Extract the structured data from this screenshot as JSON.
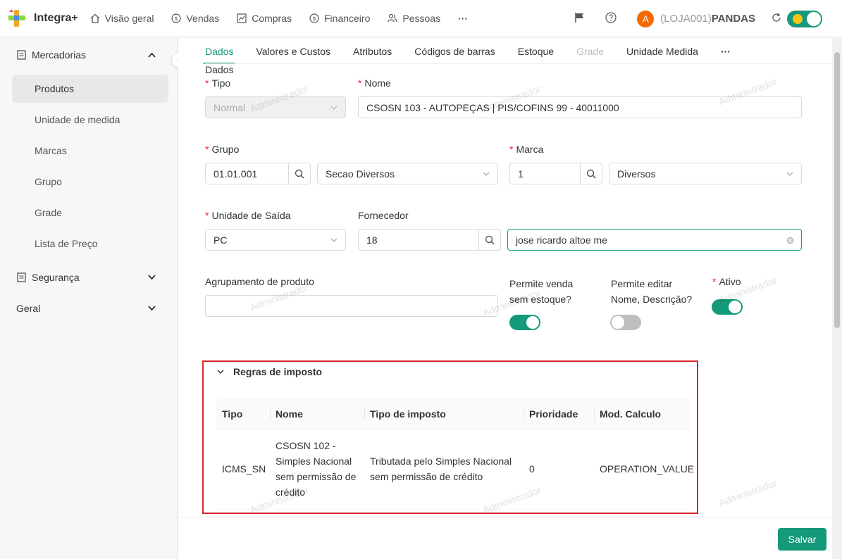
{
  "app": {
    "title": "Integra+"
  },
  "nav": {
    "items": [
      {
        "label": "Visão geral",
        "icon": "home-icon"
      },
      {
        "label": "Vendas",
        "icon": "dollar-icon"
      },
      {
        "label": "Compras",
        "icon": "chart-icon"
      },
      {
        "label": "Financeiro",
        "icon": "dollar-icon"
      },
      {
        "label": "Pessoas",
        "icon": "users-icon"
      }
    ],
    "more": "···"
  },
  "user": {
    "avatar_letter": "A",
    "store_code": "(LOJA001)",
    "store_name": "PANDAS"
  },
  "sidebar": {
    "groups": [
      {
        "label": "Mercadorias",
        "icon": "box-icon",
        "expanded": true
      },
      {
        "label": "Segurança",
        "icon": "lock-icon",
        "expanded": false
      },
      {
        "label": "Geral",
        "expanded": false
      }
    ],
    "items": [
      "Produtos",
      "Unidade de medida",
      "Marcas",
      "Grupo",
      "Grade",
      "Lista de Preço"
    ],
    "active_item": "Produtos"
  },
  "tabs": [
    "Dados",
    "Valores e Custos",
    "Atributos",
    "Códigos de barras",
    "Estoque",
    "Grade",
    "Unidade Medida",
    "···"
  ],
  "section_title": "Dados",
  "form": {
    "tipo": {
      "label": "Tipo",
      "value": "Normal"
    },
    "nome": {
      "label": "Nome",
      "value": "CSOSN 103 - AUTOPEÇAS | PIS/COFINS 99 - 40011000"
    },
    "grupo": {
      "label": "Grupo",
      "code": "01.01.001",
      "value": "Secao Diversos"
    },
    "marca": {
      "label": "Marca",
      "code": "1",
      "value": "Diversos"
    },
    "unidade_saida": {
      "label": "Unidade de Saída",
      "value": "PC"
    },
    "fornecedor": {
      "label": "Fornecedor",
      "code": "18",
      "value": "jose ricardo altoe me"
    },
    "agrupamento": {
      "label": "Agrupamento de produto",
      "value": ""
    },
    "permite_venda": {
      "label_line1": "Permite venda",
      "label_line2": "sem estoque?",
      "on": true
    },
    "permite_editar": {
      "label_line1": "Permite editar",
      "label_line2": "Nome, Descrição?",
      "on": false
    },
    "ativo": {
      "label": "Ativo",
      "on": true
    }
  },
  "tax_rules": {
    "title": "Regras de imposto",
    "columns": [
      "Tipo",
      "Nome",
      "Tipo de imposto",
      "Prioridade",
      "Mod. Calculo"
    ],
    "row": {
      "tipo": "ICMS_SN",
      "nome_lines": [
        "CSOSN 102 -",
        "Simples Nacional",
        "sem permissão de",
        "crédito"
      ],
      "tipo_imposto_lines": [
        "Tributada pelo Simples Nacional",
        "sem permissão de crédito"
      ],
      "prioridade": "0",
      "mod_calculo": "OPERATION_VALUE"
    }
  },
  "actions": {
    "save": "Salvar"
  },
  "watermark": "Administrador",
  "colors": {
    "accent": "#14997a",
    "highlight_border": "#d9252f",
    "avatar": "#f56a00"
  }
}
